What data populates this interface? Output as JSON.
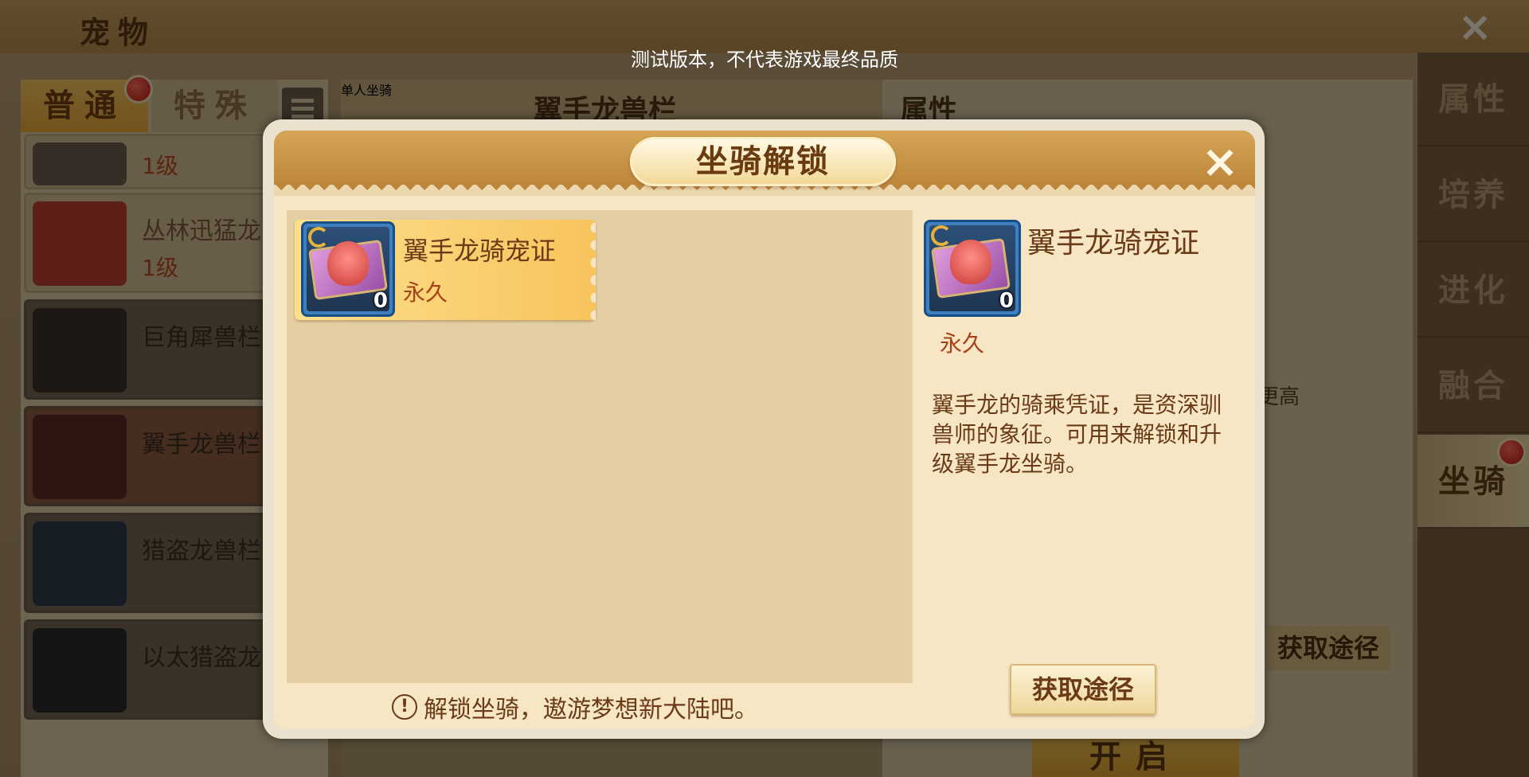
{
  "watermark": "测试版本，不代表游戏最终品质",
  "background": {
    "title": "宠物",
    "tabs": {
      "normal": "普通",
      "special": "特殊"
    },
    "filter_label": "单人坐骑",
    "mid_title": "翼手龙兽栏",
    "right_title": "属性",
    "pets": [
      {
        "name": "",
        "level": "1级"
      },
      {
        "name": "丛林迅猛龙",
        "level": "1级"
      },
      {
        "name": "巨角犀兽栏",
        "level": ""
      },
      {
        "name": "翼手龙兽栏",
        "level": ""
      },
      {
        "name": "猎盗龙兽栏",
        "level": ""
      },
      {
        "name": "以太猎盗龙",
        "level": ""
      }
    ],
    "side_tabs": [
      "属性",
      "培养",
      "进化",
      "融合",
      "坐骑"
    ],
    "partial_text": "更高",
    "get_button": "获取途径",
    "open_button": "开启"
  },
  "modal": {
    "title": "坐骑解锁",
    "item": {
      "name": "翼手龙骑宠证",
      "duration": "永久",
      "count": "0"
    },
    "detail": {
      "name": "翼手龙骑宠证",
      "duration": "永久",
      "count": "0",
      "description": "翼手龙的骑乘凭证，是资深驯兽师的象征。可用来解锁和升级翼手龙坐骑。"
    },
    "get_button": "获取途径",
    "hint": "解锁坐骑，遨游梦想新大陆吧。",
    "hint_icon": "!"
  },
  "icons": {
    "close": "×",
    "item_icon": "pterodactyl-mount-certificate-icon"
  }
}
